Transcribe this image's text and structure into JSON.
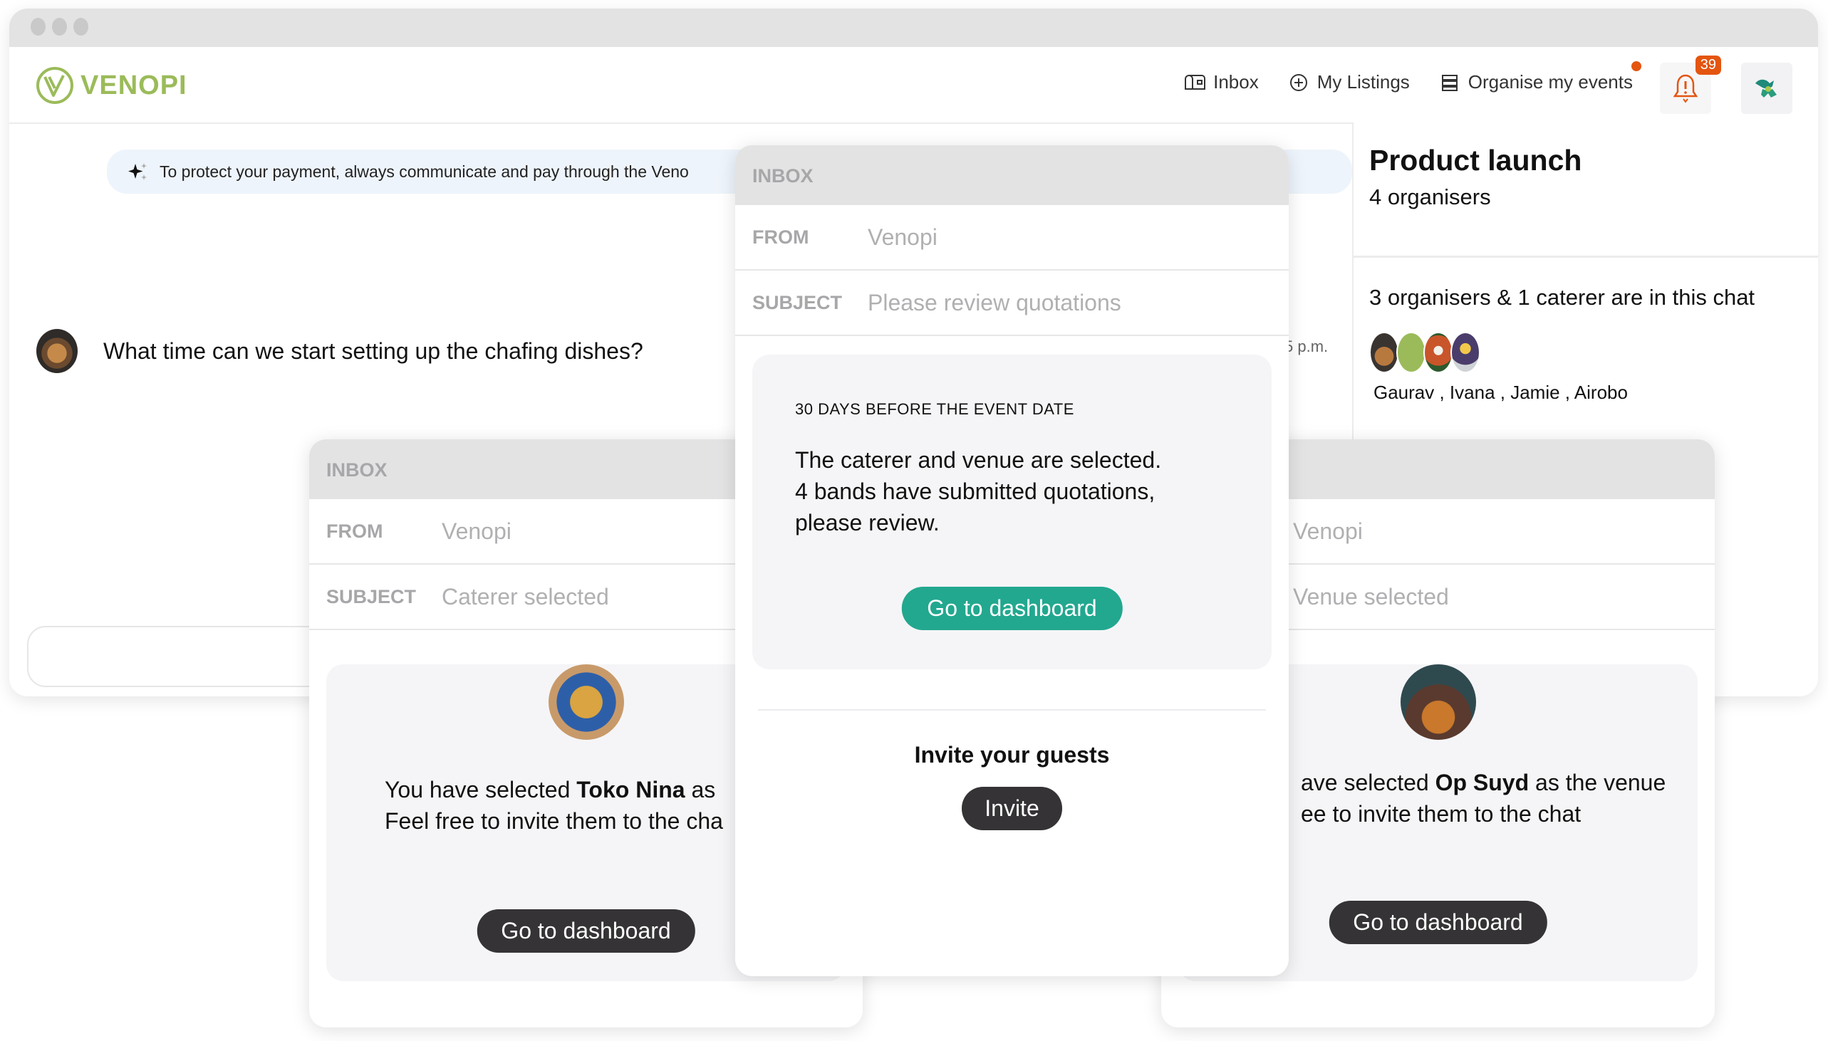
{
  "app": {
    "brand": "VENOPI",
    "nav": {
      "inbox": "Inbox",
      "my_listings": "My Listings",
      "organise": "Organise my events",
      "notifications_count": "39"
    },
    "colors": {
      "brand": "#9bbb5a",
      "accent": "#22a88f",
      "alert": "#e4550f",
      "dark_button": "#353335"
    }
  },
  "chat": {
    "notice": "To protect your payment, always communicate and pay through the Veno",
    "message": {
      "text": "What time can we start setting up the chafing dishes?",
      "timestamp": "5 p.m."
    },
    "input_placeholder": ""
  },
  "event_panel": {
    "title": "Product launch",
    "subtitle": "4 organisers",
    "members_line": "3 organisers & 1 caterer are in this chat",
    "member_names": "Gaurav , Ivana , Jamie , Airobo"
  },
  "cards": {
    "left": {
      "header": "INBOX",
      "from_label": "FROM",
      "from_value": "Venopi",
      "subject_label": "SUBJECT",
      "subject_value": "Caterer selected",
      "line1_pre": "You have selected ",
      "line1_bold": "Toko Nina",
      "line1_post": " as",
      "line2": "Feel free to invite them to the cha",
      "button": "Go to dashboard"
    },
    "center": {
      "header": "INBOX",
      "from_label": "FROM",
      "from_value": "Venopi",
      "subject_label": "SUBJECT",
      "subject_value": "Please review quotations",
      "kicker": "30 DAYS BEFORE THE EVENT DATE",
      "line1": "The caterer and venue are selected.",
      "line2": "4 bands have submitted quotations,",
      "line3": "please review.",
      "button": "Go to dashboard",
      "invite_title": "Invite your guests",
      "invite_button": "Invite"
    },
    "right": {
      "from_value": "Venopi",
      "subject_value": "Venue selected",
      "line1_pre": "ave selected ",
      "line1_bold": "Op Suyd",
      "line1_post": " as the venue",
      "line2": "ee to invite them to the chat",
      "button": "Go to dashboard"
    }
  }
}
